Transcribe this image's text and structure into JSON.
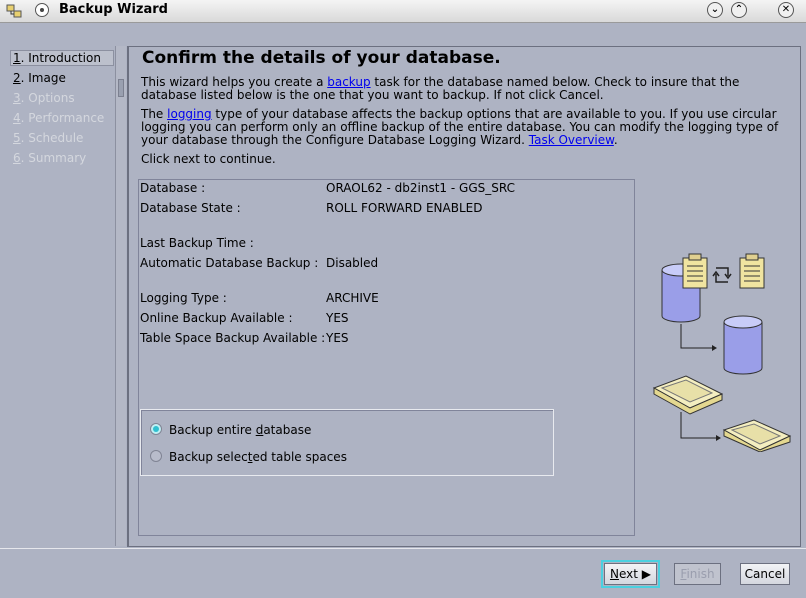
{
  "window": {
    "title": "Backup Wizard"
  },
  "nav": {
    "items": [
      {
        "num": "1",
        "label": ". Introduction",
        "state": "selected"
      },
      {
        "num": "2",
        "label": ". Image",
        "state": "enabled"
      },
      {
        "num": "3",
        "label": ". Options",
        "state": "disabled"
      },
      {
        "num": "4",
        "label": ". Performance",
        "state": "disabled"
      },
      {
        "num": "5",
        "label": ". Schedule",
        "state": "disabled"
      },
      {
        "num": "6",
        "label": ". Summary",
        "state": "disabled"
      }
    ]
  },
  "main": {
    "heading": "Confirm the details of your database.",
    "p1_a": "This wizard helps you create a ",
    "p1_link": "backup",
    "p1_b": " task for the database named below. Check to insure that the database listed below is the one that you want to backup. If not click Cancel.",
    "p2_a": "The ",
    "p2_link": "logging",
    "p2_b": " type of your database affects the backup options that are available to you. If you use circular logging you can perform only an offline backup of the entire database. You can modify the logging type of your database through the Configure Database Logging Wizard. ",
    "p2_link2": "Task Overview",
    "p2_c": ".",
    "p3": "Click next to continue."
  },
  "details": {
    "database_label": "Database :",
    "database_value": "ORAOL62 - db2inst1 - GGS_SRC",
    "state_label": "Database State :",
    "state_value": "ROLL FORWARD ENABLED",
    "last_backup_label": "Last Backup Time :",
    "auto_backup_label": "Automatic Database Backup :",
    "auto_backup_value": "Disabled",
    "logging_label": "Logging Type :",
    "logging_value": "ARCHIVE",
    "online_label": "Online Backup Available :",
    "online_value": "YES",
    "tablespace_label": "Table Space Backup Available :",
    "tablespace_value": "YES"
  },
  "options": {
    "entire_a": "Backup entire ",
    "entire_u": "d",
    "entire_b": "atabase",
    "selected_a": "Backup selec",
    "selected_u": "t",
    "selected_b": "ed table spaces",
    "selected_option": "entire"
  },
  "buttons": {
    "next_u": "N",
    "next_rest": "ext",
    "finish_u": "F",
    "finish_rest": "inish",
    "cancel": "Cancel"
  },
  "colors": {
    "accent": "#4ad0e0",
    "link": "#0000ee",
    "background": "#aeb3c3"
  }
}
